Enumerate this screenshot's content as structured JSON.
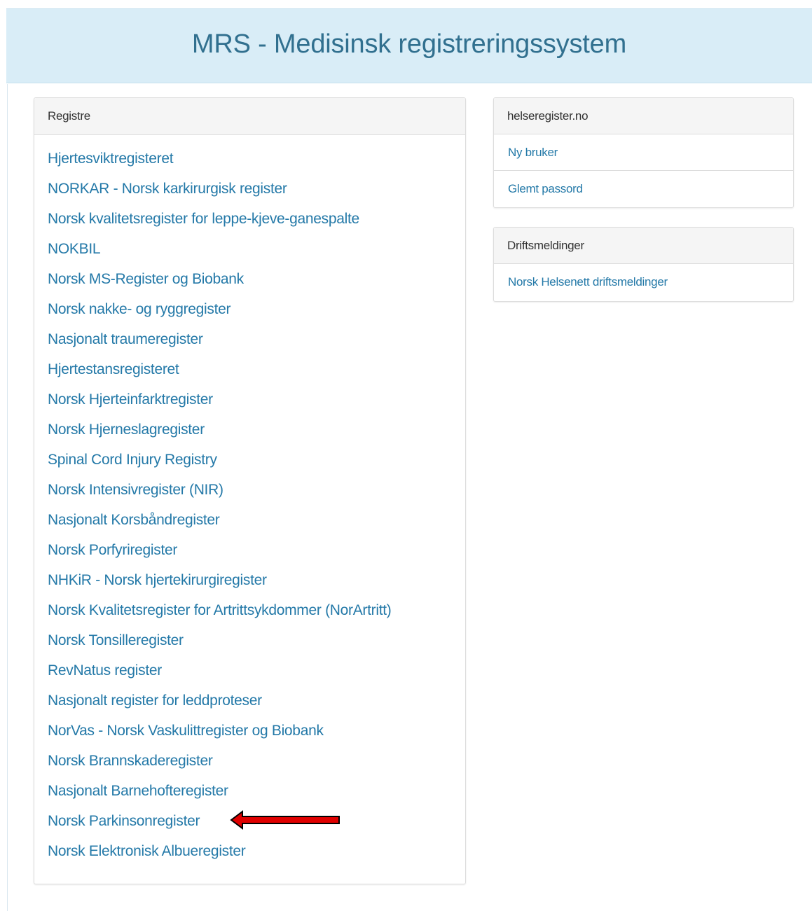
{
  "header": {
    "title": "MRS - Medisinsk registreringssystem"
  },
  "registries_panel": {
    "heading": "Registre",
    "items": [
      "Hjertesviktregisteret",
      "NORKAR - Norsk karkirurgisk register",
      "Norsk kvalitetsregister for leppe-kjeve-ganespalte",
      "NOKBIL",
      "Norsk MS-Register og Biobank",
      "Norsk nakke- og ryggregister",
      "Nasjonalt traumeregister",
      "Hjertestansregisteret",
      "Norsk Hjerteinfarktregister",
      "Norsk Hjerneslagregister",
      "Spinal Cord Injury Registry",
      "Norsk Intensivregister (NIR)",
      "Nasjonalt Korsbåndregister",
      "Norsk Porfyriregister",
      "NHKiR - Norsk hjertekirurgiregister",
      "Norsk Kvalitetsregister for Artrittsykdommer (NorArtritt)",
      "Norsk Tonsilleregister",
      "RevNatus register",
      "Nasjonalt register for leddproteser",
      "NorVas - Norsk Vaskulittregister og Biobank",
      "Norsk Brannskaderegister",
      "Nasjonalt Barnehofteregister",
      "Norsk Parkinsonregister",
      "Norsk Elektronisk Albueregister"
    ]
  },
  "helseregister_panel": {
    "heading": "helseregister.no",
    "items": [
      "Ny bruker",
      "Glemt passord"
    ]
  },
  "drift_panel": {
    "heading": "Driftsmeldinger",
    "items": [
      "Norsk Helsenett driftsmeldinger"
    ]
  },
  "annotation": {
    "icon": "red-arrow-left-icon",
    "color": "#e00000"
  },
  "colors": {
    "banner_bg": "#d9edf7",
    "title": "#31708f",
    "link": "#2479a8"
  }
}
